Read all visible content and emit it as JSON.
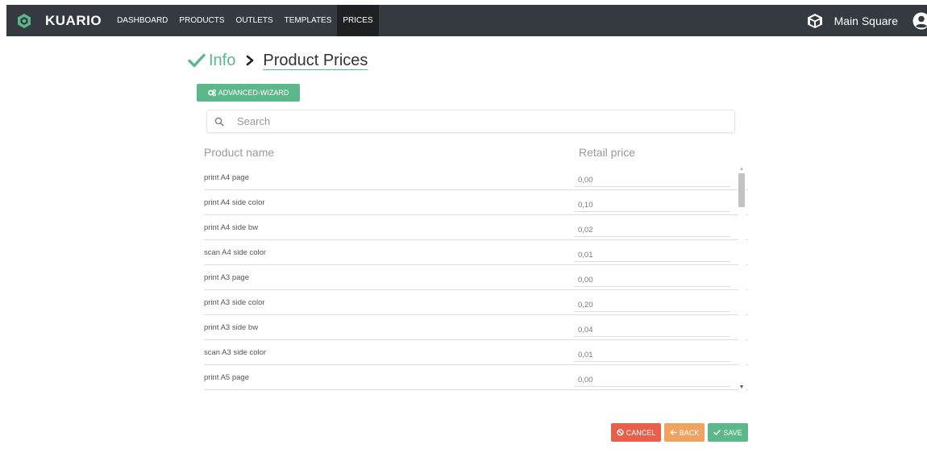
{
  "app": {
    "brand": "KUARIO"
  },
  "nav": {
    "items": [
      {
        "label": "DASHBOARD",
        "active": false
      },
      {
        "label": "PRODUCTS",
        "active": false
      },
      {
        "label": "OUTLETS",
        "active": false
      },
      {
        "label": "TEMPLATES",
        "active": false
      },
      {
        "label": "PRICES",
        "active": true
      }
    ],
    "store_name": "Main Square"
  },
  "breadcrumb": {
    "previous": "Info",
    "current": "Product Prices"
  },
  "wizard_button": "ADVANCED-WIZARD",
  "search": {
    "placeholder": "Search",
    "value": ""
  },
  "table": {
    "headers": {
      "name": "Product name",
      "price": "Retail price"
    },
    "rows": [
      {
        "name": "print A4 page",
        "price": "0,00"
      },
      {
        "name": "print A4 side color",
        "price": "0,10"
      },
      {
        "name": "print A4 side bw",
        "price": "0,02"
      },
      {
        "name": "scan A4 side color",
        "price": "0,01"
      },
      {
        "name": "print A3 page",
        "price": "0,00"
      },
      {
        "name": "print A3 side color",
        "price": "0,20"
      },
      {
        "name": "print A3 side bw",
        "price": "0,04"
      },
      {
        "name": "scan A3 side color",
        "price": "0,01"
      },
      {
        "name": "print A5 page",
        "price": "0,00"
      }
    ]
  },
  "footer": {
    "cancel": "CANCEL",
    "back": "BACK",
    "save": "SAVE"
  },
  "colors": {
    "navbar": "#343a40",
    "accent_green": "#5cb88a",
    "cancel_red": "#e8604c",
    "back_orange": "#f0a260"
  },
  "icons": {
    "brand": "kuario-logo-icon",
    "store": "cube-icon",
    "user": "user-circle-icon",
    "info_check": "check-icon",
    "separator": "chevron-right-icon",
    "wizard": "gears-icon",
    "search": "search-icon",
    "cancel": "ban-icon",
    "back": "arrow-left-icon",
    "save": "check-icon"
  }
}
